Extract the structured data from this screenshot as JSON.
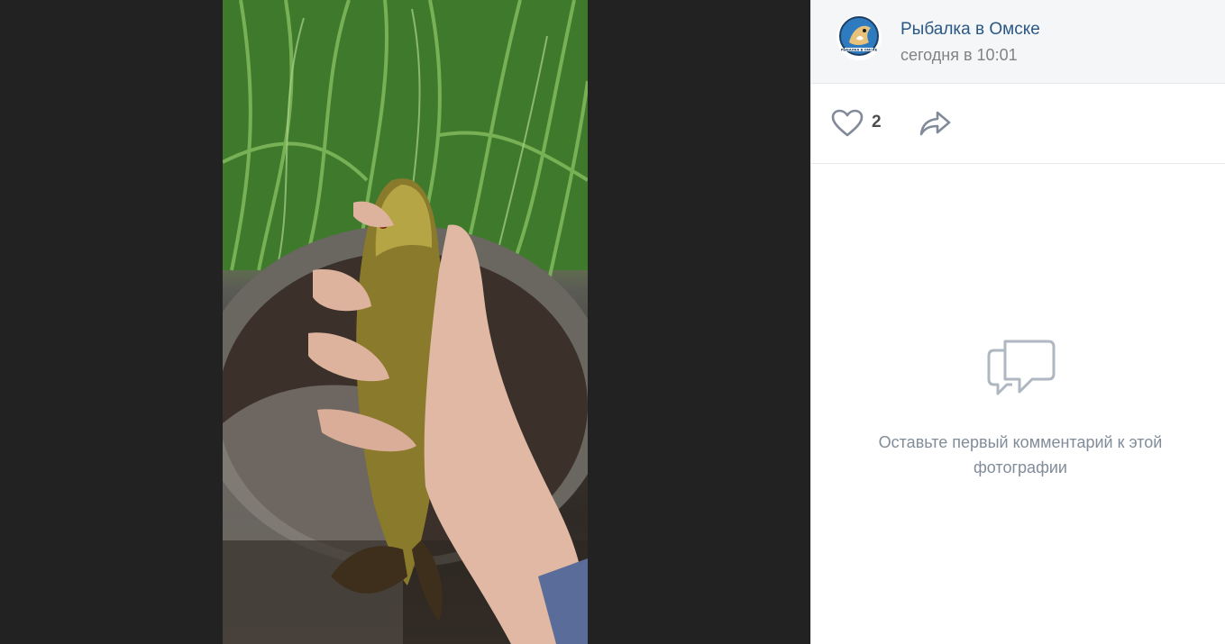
{
  "post": {
    "author": "Рыбалка в Омске",
    "time": "сегодня в 10:01",
    "avatar_icon": "group-logo-fish-icon",
    "avatar_text": "РЫБАЛКА В ОМСКЕ"
  },
  "actions": {
    "like_icon": "heart-icon",
    "likes": "2",
    "share_icon": "share-arrow-icon"
  },
  "comments": {
    "empty_icon": "speech-bubbles-icon",
    "empty_text": "Оставьте первый комментарий к этой фотографии"
  },
  "photo": {
    "subject": "fish-photo"
  },
  "colors": {
    "link": "#2a5885",
    "muted": "#828282",
    "icon": "#818c99"
  }
}
